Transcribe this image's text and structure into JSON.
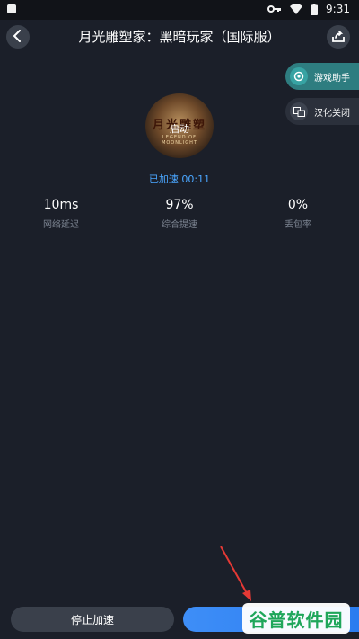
{
  "status_bar": {
    "time": "9:31"
  },
  "header": {
    "title": "月光雕塑家：黑暗玩家（国际服）",
    "back_icon": "chevron-left-icon",
    "share_icon": "share-icon"
  },
  "side_actions": {
    "assistant_label": "游戏助手",
    "translate_label": "汉化关闭"
  },
  "game": {
    "logo_text": "月光雕塑",
    "start_label": "启动",
    "logo_sub": "LEGEND OF MOONLIGHT"
  },
  "status": {
    "accelerated_label": "已加速 00:11"
  },
  "stats": [
    {
      "value": "10ms",
      "label": "网络延迟"
    },
    {
      "value": "97%",
      "label": "综合提速"
    },
    {
      "value": "0%",
      "label": "丢包率"
    }
  ],
  "bottom": {
    "stop_label": "停止加速",
    "watermark": "谷普软件园"
  },
  "colors": {
    "background": "#1b1f29",
    "accent_blue": "#3e8ef7",
    "teal": "#2e7d80",
    "arrow_red": "#e53935"
  }
}
